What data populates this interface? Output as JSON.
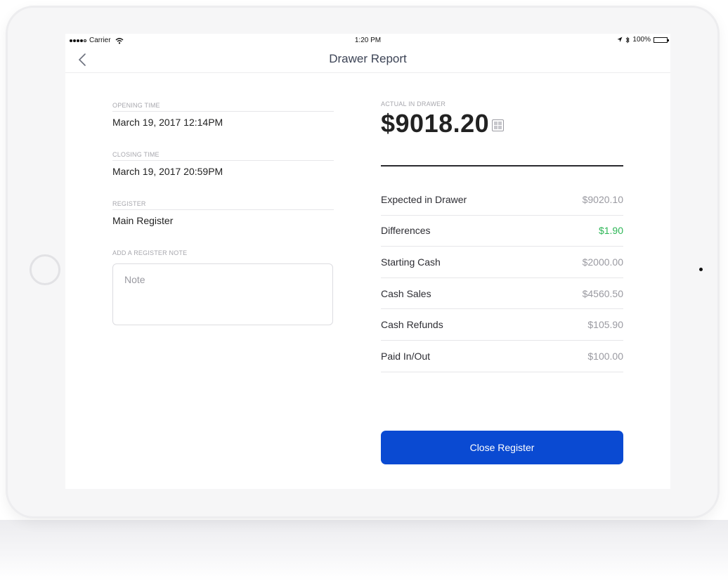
{
  "status_bar": {
    "carrier": "Carrier",
    "time": "1:20 PM",
    "battery": "100%"
  },
  "nav": {
    "title": "Drawer Report"
  },
  "fields": {
    "opening_time_label": "OPENING TIME",
    "opening_time_value": "March 19, 2017 12:14PM",
    "closing_time_label": "CLOSING TIME",
    "closing_time_value": "March 19, 2017 20:59PM",
    "register_label": "REGISTER",
    "register_value": "Main Register",
    "note_label": "ADD A REGISTER NOTE",
    "note_placeholder": "Note"
  },
  "drawer": {
    "actual_label": "ACTUAL IN DRAWER",
    "actual_amount": "$9018.20"
  },
  "summary": {
    "rows": [
      {
        "label": "Expected in Drawer",
        "value": "$9020.10"
      },
      {
        "label": "Differences",
        "value": "$1.90"
      },
      {
        "label": "Starting Cash",
        "value": "$2000.00"
      },
      {
        "label": "Cash Sales",
        "value": "$4560.50"
      },
      {
        "label": "Cash Refunds",
        "value": "$105.90"
      },
      {
        "label": "Paid In/Out",
        "value": "$100.00"
      }
    ]
  },
  "actions": {
    "close_register": "Close Register"
  },
  "colors": {
    "primary_button": "#0a4ad2",
    "positive_value": "#2db656"
  }
}
